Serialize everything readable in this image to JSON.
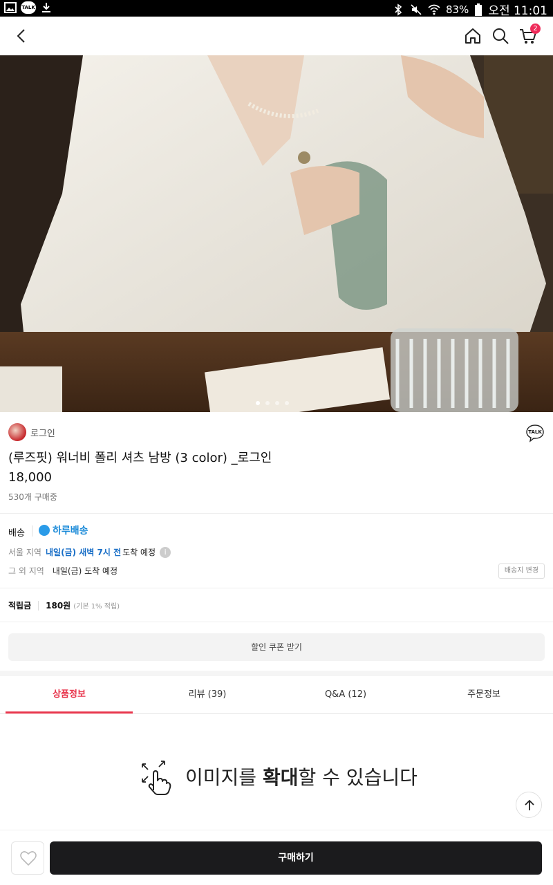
{
  "status_bar": {
    "left_icons": [
      "gallery-icon",
      "kakaotalk-icon",
      "download-icon"
    ],
    "talk_label": "TALK",
    "battery": "83%",
    "time": "오전 11:01"
  },
  "header": {
    "icons": [
      "back-icon",
      "home-icon",
      "search-icon",
      "cart-icon"
    ],
    "cart_count": "2"
  },
  "hero": {
    "page_indicator_count": 4,
    "active_index": 0
  },
  "product": {
    "store_name": "로그인",
    "talk_label": "TALK",
    "title": "(루즈핏) 워너비 폴리 셔츠 남방 (3 color) _로그인",
    "price": "18,000",
    "buying_count": "530개 구매중"
  },
  "shipping": {
    "label": "배송",
    "service": "하루배송",
    "seoul_label": "서울 지역",
    "seoul_time": "내일(금) 새벽 7시 전",
    "seoul_suffix": "도착 예정",
    "other_label": "그 외 지역",
    "other_value": "내일(금) 도착 예정",
    "change_button": "배송지 변경"
  },
  "points": {
    "label": "적립금",
    "amount": "180원",
    "note": "(기본 1% 적립)"
  },
  "coupon_button": "할인 쿠폰 받기",
  "tabs": [
    {
      "label": "상품정보",
      "active": true
    },
    {
      "label": "리뷰 (39)",
      "active": false
    },
    {
      "label": "Q&A (12)",
      "active": false
    },
    {
      "label": "주문정보",
      "active": false
    }
  ],
  "zoom_hint": {
    "prefix": "이미지를",
    "bold": "확대",
    "suffix": "할 수 있습니다"
  },
  "bottom_bar": {
    "buy_label": "구매하기"
  },
  "colors": {
    "accent": "#e8354c",
    "shipping_blue": "#1a8ad8",
    "buy_button": "#1b1b1d"
  }
}
